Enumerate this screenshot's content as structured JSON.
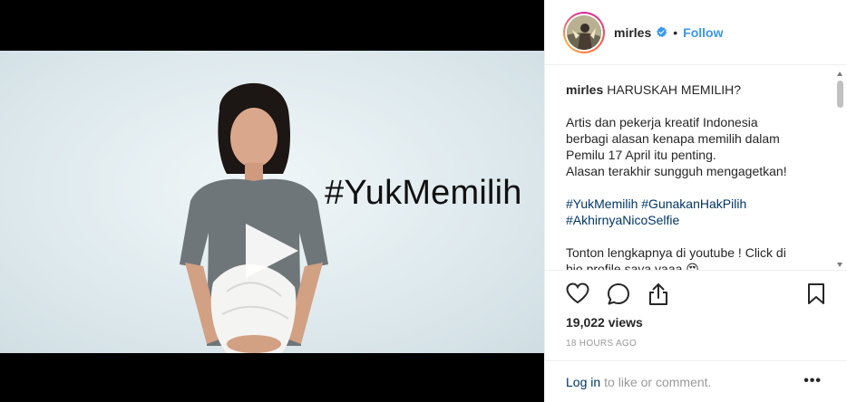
{
  "video": {
    "overlay_text": "#YukMemilih"
  },
  "header": {
    "username": "mirles",
    "separator": "•",
    "follow_label": "Follow"
  },
  "caption": {
    "username": "mirles",
    "title": "HARUSKAH MEMILIH?",
    "line1": "Artis dan pekerja kreatif Indonesia",
    "line2": "berbagi alasan kenapa memilih dalam",
    "line3": "Pemilu 17 April itu penting.",
    "line4": "Alasan terakhir sungguh mengagetkan!",
    "hashtags_line1": [
      "#YukMemilih",
      "#GunakanHakPilih"
    ],
    "hashtags_line2": [
      "#AkhirnyaNicoSelfie"
    ],
    "tail_line1": "Tonton lengkapnya di youtube ! Click di",
    "tail_line2": "bio profile saya yaaa 😍"
  },
  "icons": {
    "like": "heart-icon",
    "comment": "comment-icon",
    "share": "share-icon",
    "save": "bookmark-icon",
    "verified": "verified-badge-icon",
    "play": "play-icon"
  },
  "stats": {
    "views": "19,022 views",
    "time": "18 HOURS AGO"
  },
  "footer": {
    "login_label": "Log in",
    "login_rest": "to like or comment.",
    "more_label": "•••"
  },
  "colors": {
    "link_blue": "#3897f0",
    "hashtag_blue": "#003569",
    "verified_blue": "#3897f0",
    "muted": "#999999"
  }
}
